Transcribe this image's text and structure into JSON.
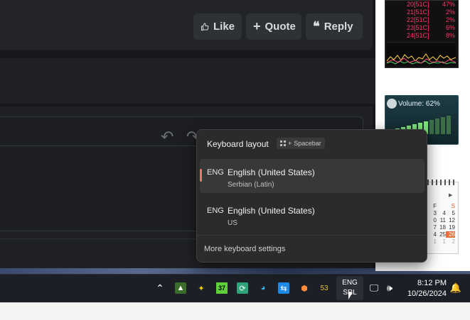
{
  "post_actions": {
    "like_label": "Like",
    "quote_label": "Quote",
    "reply_label": "Reply"
  },
  "cpu_widget": {
    "rows": [
      {
        "label": "20[51C]",
        "pct": "47%"
      },
      {
        "label": "21[51C]",
        "pct": "2%"
      },
      {
        "label": "22[51C]",
        "pct": "2%"
      },
      {
        "label": "23[51C]",
        "pct": "6%"
      },
      {
        "label": "24[51C]",
        "pct": "8%"
      }
    ]
  },
  "volume_widget": {
    "label": "Volume: 62%"
  },
  "calendar_widget": {
    "rows": [
      [
        "",
        "",
        ""
      ],
      [
        "F",
        "",
        "S"
      ],
      [
        "3",
        "4",
        "5"
      ],
      [
        "0",
        "11",
        "12"
      ],
      [
        "7",
        "18",
        "19"
      ],
      [
        "4",
        "25",
        "26"
      ],
      [
        "1",
        "1",
        "2"
      ]
    ]
  },
  "keyboard_flyout": {
    "title": "Keyboard layout",
    "shortcut_plus": "+",
    "shortcut_key": "Spacebar",
    "items": [
      {
        "code": "ENG",
        "name": "English (United States)",
        "sub": "Serbian (Latin)",
        "selected": true
      },
      {
        "code": "ENG",
        "name": "English (United States)",
        "sub": "US",
        "selected": false
      }
    ],
    "more_settings": "More keyboard settings"
  },
  "taskbar": {
    "tray_badge": "53",
    "badge_37": "37",
    "lang_line1": "ENG",
    "lang_line2": "SRL",
    "time": "8:12 PM",
    "date": "10/26/2024"
  },
  "colors": {
    "accent_selected": "#f0766d",
    "flyout_bg": "#2b2b2b",
    "taskbar_bg": "#1d1f27"
  }
}
